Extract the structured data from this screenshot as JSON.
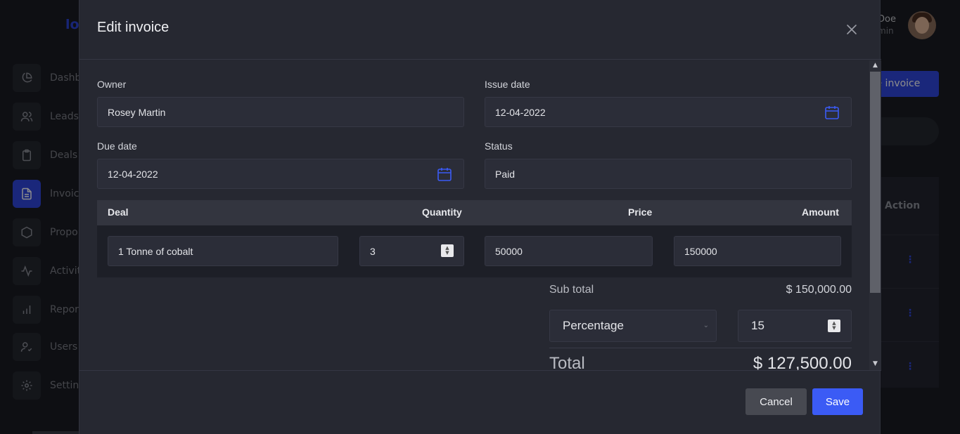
{
  "background": {
    "logo": "lo",
    "user": {
      "name": "Doe",
      "role": "min"
    },
    "nav": [
      {
        "label": "Dashb",
        "icon": "pie-chart-icon"
      },
      {
        "label": "Leads",
        "icon": "users-icon"
      },
      {
        "label": "Deals",
        "icon": "clipboard-icon"
      },
      {
        "label": "Invoic",
        "icon": "document-icon"
      },
      {
        "label": "Propo",
        "icon": "hexagon-icon"
      },
      {
        "label": "Activit",
        "icon": "activity-icon"
      },
      {
        "label": "Repor",
        "icon": "bar-chart-icon"
      },
      {
        "label": "Users",
        "icon": "user-check-icon"
      },
      {
        "label": "Settin",
        "icon": "gear-icon"
      }
    ],
    "create_button": "te invoice",
    "table_action_header": "Action",
    "row_action": "⋮"
  },
  "modal": {
    "title": "Edit invoice",
    "owner": {
      "label": "Owner",
      "value": "Rosey Martin"
    },
    "issue_date": {
      "label": "Issue date",
      "value": "12-04-2022"
    },
    "due_date": {
      "label": "Due date",
      "value": "12-04-2022"
    },
    "status": {
      "label": "Status",
      "value": "Paid"
    },
    "table": {
      "headers": {
        "deal": "Deal",
        "quantity": "Quantity",
        "price": "Price",
        "amount": "Amount"
      },
      "row": {
        "deal": "1 Tonne of cobalt",
        "quantity": "3",
        "price": "50000",
        "amount": "150000"
      }
    },
    "summary": {
      "subtotal_label": "Sub total",
      "subtotal_value": "$ 150,000.00",
      "discount_type": "Percentage",
      "discount_value": "15",
      "total_label": "Total",
      "total_value": "$ 127,500.00"
    },
    "footer": {
      "cancel": "Cancel",
      "save": "Save"
    }
  },
  "colors": {
    "accent": "#3b5bf5",
    "modal_bg": "#262831",
    "input_bg": "#2b2d38"
  }
}
